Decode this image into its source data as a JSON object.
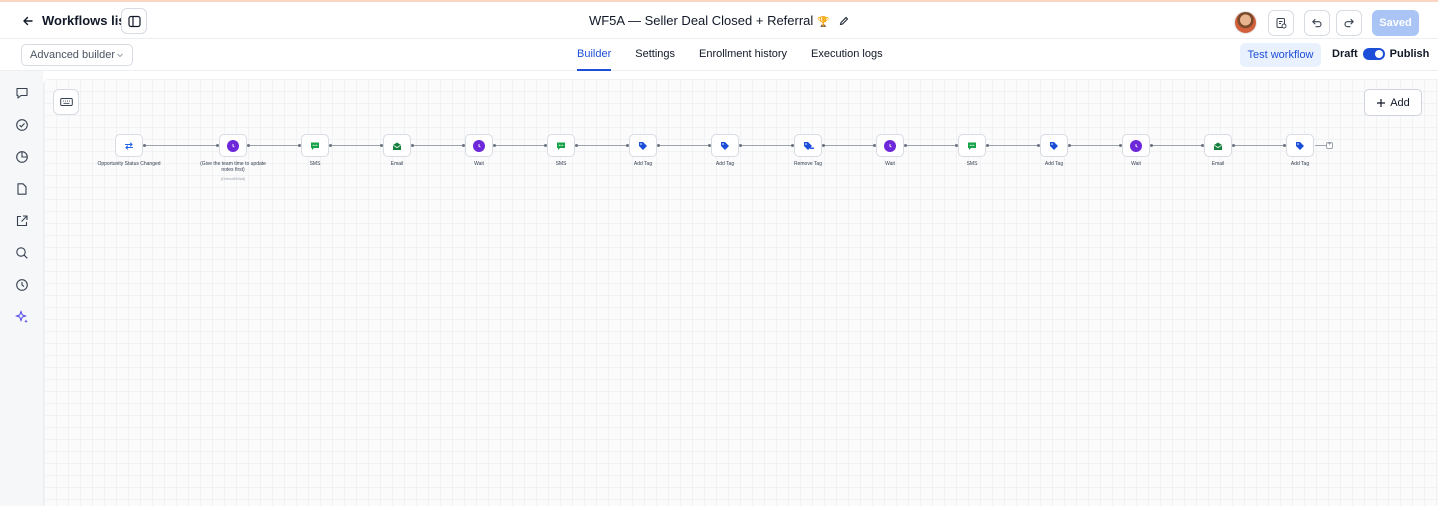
{
  "header": {
    "back_label": "Workflows list",
    "title": "WF5A — Seller Deal Closed + Referral",
    "title_emoji": "🏆",
    "saved_label": "Saved"
  },
  "subheader": {
    "builder_mode": "Advanced builder",
    "tabs": [
      {
        "label": "Builder",
        "active": true
      },
      {
        "label": "Settings",
        "active": false
      },
      {
        "label": "Enrollment history",
        "active": false
      },
      {
        "label": "Execution logs",
        "active": false
      }
    ],
    "test_label": "Test workflow",
    "draft_label": "Draft",
    "publish_label": "Publish",
    "published": true
  },
  "sidebar": {
    "icons": [
      "chat-icon",
      "check-circle-icon",
      "pie-chart-icon",
      "file-icon",
      "external-link-icon",
      "search-icon",
      "history-icon",
      "sparkles-icon"
    ]
  },
  "canvas": {
    "add_label": "Add",
    "nodes": [
      {
        "label": "Opportunity Status Changed",
        "icon": "swap-icon",
        "color": "#2563eb"
      },
      {
        "label": "(Give the team time to update notes first)",
        "sub": "(Default/Wait)",
        "icon": "clock-icon",
        "color": "#6d28d9"
      },
      {
        "label": "SMS",
        "icon": "sms-icon",
        "color": "#16a34a"
      },
      {
        "label": "Email",
        "icon": "email-icon",
        "color": "#15803d"
      },
      {
        "label": "Wait",
        "icon": "clock-icon",
        "color": "#6d28d9"
      },
      {
        "label": "SMS",
        "icon": "sms-icon",
        "color": "#16a34a"
      },
      {
        "label": "Add Tag",
        "icon": "tag-icon",
        "color": "#1d4ed8"
      },
      {
        "label": "Add Tag",
        "icon": "tag-icon",
        "color": "#1d4ed8"
      },
      {
        "label": "Remove Tag",
        "icon": "remove-tag-icon",
        "color": "#1d4ed8"
      },
      {
        "label": "Wait",
        "icon": "clock-icon",
        "color": "#6d28d9"
      },
      {
        "label": "SMS",
        "icon": "sms-icon",
        "color": "#16a34a"
      },
      {
        "label": "Add Tag",
        "icon": "tag-icon",
        "color": "#1d4ed8"
      },
      {
        "label": "Wait",
        "icon": "clock-icon",
        "color": "#6d28d9"
      },
      {
        "label": "Email",
        "icon": "email-icon",
        "color": "#15803d"
      },
      {
        "label": "Add Tag",
        "icon": "tag-icon",
        "color": "#1d4ed8"
      }
    ]
  },
  "colors": {
    "accent": "#1d4ed8",
    "saved_bg": "#a9c4f5"
  }
}
